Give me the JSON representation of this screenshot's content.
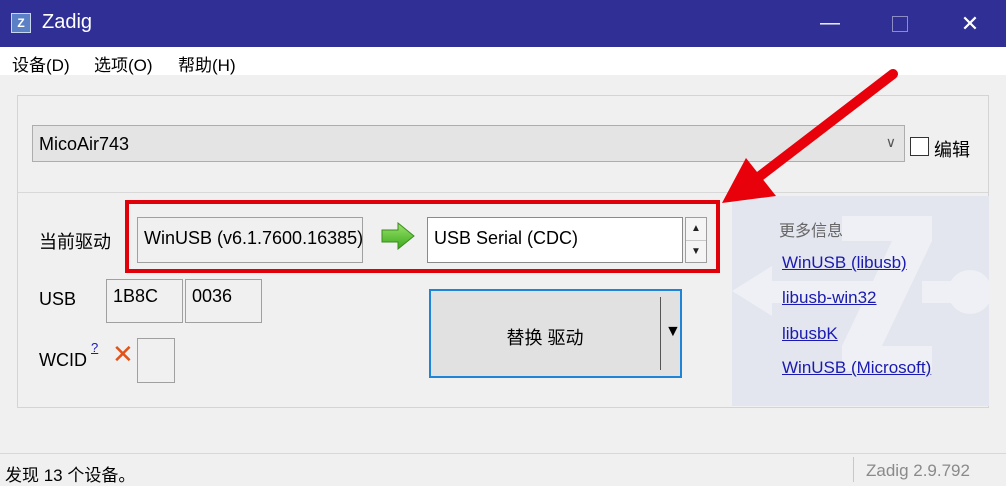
{
  "window": {
    "title": "Zadig",
    "icon_glyph": "Z",
    "minimize_glyph": "—",
    "close_glyph": "✕"
  },
  "menu": [
    {
      "label": "设备(D)"
    },
    {
      "label": "选项(O)"
    },
    {
      "label": "帮助(H)"
    }
  ],
  "device": {
    "selected": "MicoAir743",
    "dropdown_glyph": "∨",
    "edit_checked": false,
    "edit_label": "编辑"
  },
  "driver": {
    "current_label": "当前驱动",
    "current_value": "WinUSB (v6.1.7600.16385)",
    "target_value": "USB Serial (CDC)",
    "spin_up": "▲",
    "spin_down": "▼"
  },
  "usb": {
    "label": "USB",
    "vid": "1B8C",
    "pid": "0036"
  },
  "wcid": {
    "label": "WCID",
    "help": "?",
    "status_glyph": "✕"
  },
  "replace_button": {
    "label": "替换 驱动",
    "caret": "▼"
  },
  "info": {
    "title": "更多信息",
    "links": [
      {
        "label": "WinUSB (libusb)"
      },
      {
        "label": "libusb-win32"
      },
      {
        "label": "libusbK"
      },
      {
        "label": "WinUSB (Microsoft)"
      }
    ]
  },
  "status": {
    "message": "发现 13 个设备。",
    "version": "Zadig 2.9.792"
  },
  "colors": {
    "titlebar": "#2f2f96",
    "highlight": "#e0000a",
    "link": "#1a1ab0",
    "focus": "#1e84d7"
  }
}
